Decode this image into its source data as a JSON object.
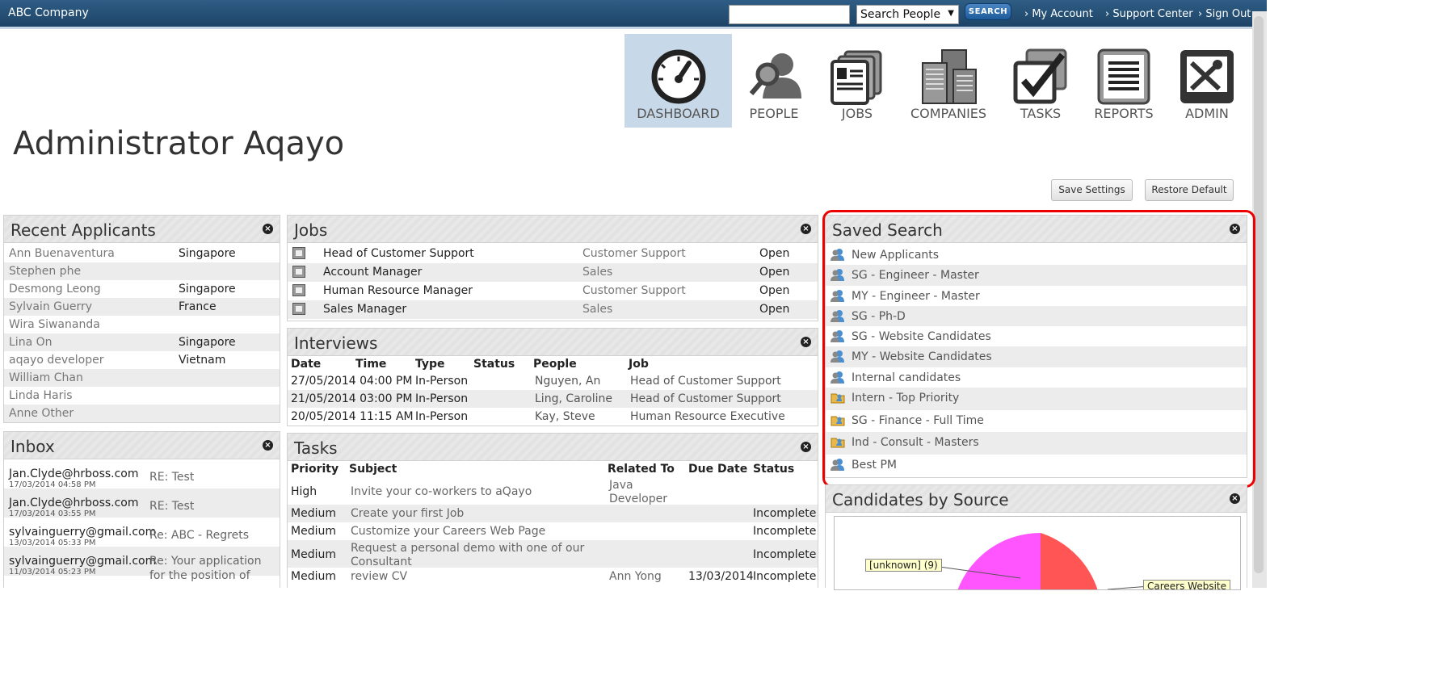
{
  "header": {
    "brand": "ABC Company",
    "search_placeholder": "",
    "search_select": "Search People",
    "search_button": "SEARCH",
    "links": [
      "My Account",
      "Support Center",
      "Sign Out"
    ]
  },
  "nav": [
    {
      "label": "DASHBOARD",
      "icon": "dashboard-gauge-icon"
    },
    {
      "label": "PEOPLE",
      "icon": "people-search-icon"
    },
    {
      "label": "JOBS",
      "icon": "jobs-cards-icon"
    },
    {
      "label": "COMPANIES",
      "icon": "companies-buildings-icon"
    },
    {
      "label": "TASKS",
      "icon": "tasks-check-icon"
    },
    {
      "label": "REPORTS",
      "icon": "reports-document-icon"
    },
    {
      "label": "ADMIN",
      "icon": "admin-tools-icon"
    }
  ],
  "page_title": "Administrator Aqayo",
  "buttons": {
    "save": "Save Settings",
    "restore": "Restore Default"
  },
  "recent_applicants": {
    "title": "Recent Applicants",
    "rows": [
      [
        "Ann Buenaventura",
        "Singapore"
      ],
      [
        "Stephen phe",
        ""
      ],
      [
        "Desmong Leong",
        "Singapore"
      ],
      [
        "Sylvain Guerry",
        "France"
      ],
      [
        "Wira Siwananda",
        ""
      ],
      [
        "Lina On",
        "Singapore"
      ],
      [
        "aqayo developer",
        "Vietnam"
      ],
      [
        "William Chan",
        ""
      ],
      [
        "Linda Haris",
        ""
      ],
      [
        "Anne Other",
        ""
      ]
    ]
  },
  "inbox": {
    "title": "Inbox",
    "rows": [
      {
        "from": "Jan.Clyde@hrboss.com",
        "date": "17/03/2014 04:58 PM",
        "subject": "RE: Test",
        "subject2": ""
      },
      {
        "from": "Jan.Clyde@hrboss.com",
        "date": "17/03/2014 03:55 PM",
        "subject": "RE: Test",
        "subject2": ""
      },
      {
        "from": "sylvainguerry@gmail.com",
        "date": "13/03/2014 05:33 PM",
        "subject": "Re: ABC - Regrets",
        "subject2": ""
      },
      {
        "from": "sylvainguerry@gmail.com",
        "date": "11/03/2014 05:23 PM",
        "subject": "Re: Your application",
        "subject2": "for the position of"
      }
    ]
  },
  "jobs": {
    "title": "Jobs",
    "rows": [
      [
        "Head of Customer Support",
        "Customer Support",
        "Open"
      ],
      [
        "Account Manager",
        "Sales",
        "Open"
      ],
      [
        "Human Resource Manager",
        "Customer Support",
        "Open"
      ],
      [
        "Sales Manager",
        "Sales",
        "Open"
      ]
    ]
  },
  "interviews": {
    "title": "Interviews",
    "headers": [
      "Date",
      "Time",
      "Type",
      "Status",
      "People",
      "Job"
    ],
    "rows": [
      [
        "27/05/2014",
        "04:00 PM",
        "In-Person",
        "",
        "Nguyen, An",
        "Head of Customer Support"
      ],
      [
        "21/05/2014",
        "03:00 PM",
        "In-Person",
        "",
        "Ling, Caroline",
        "Head of Customer Support"
      ],
      [
        "20/05/2014",
        "11:15 AM",
        "In-Person",
        "",
        "Kay, Steve",
        "Human Resource Executive"
      ]
    ]
  },
  "tasks": {
    "title": "Tasks",
    "headers": [
      "Priority",
      "Subject",
      "Related To",
      "Due Date",
      "Status"
    ],
    "rows": [
      {
        "priority": "High",
        "subject": "Invite your co-workers to aQayo",
        "subject2": "",
        "related": "Java",
        "related2": "Developer",
        "due": "",
        "status": ""
      },
      {
        "priority": "Medium",
        "subject": "Create your first Job",
        "subject2": "",
        "related": "",
        "related2": "",
        "due": "",
        "status": "Incomplete"
      },
      {
        "priority": "Medium",
        "subject": "Customize your Careers Web Page",
        "subject2": "",
        "related": "",
        "related2": "",
        "due": "",
        "status": "Incomplete"
      },
      {
        "priority": "Medium",
        "subject": "Request a personal demo with one of our",
        "subject2": "Consultant",
        "related": "",
        "related2": "",
        "due": "",
        "status": "Incomplete"
      },
      {
        "priority": "Medium",
        "subject": "review CV",
        "subject2": "",
        "related": "Ann Yong",
        "related2": "",
        "due": "13/03/2014",
        "status": "Incomplete"
      }
    ]
  },
  "saved_search": {
    "title": "Saved Search",
    "items": [
      {
        "label": "New Applicants",
        "icon": "people-icon"
      },
      {
        "label": "SG - Engineer - Master",
        "icon": "people-icon"
      },
      {
        "label": "MY - Engineer - Master",
        "icon": "people-icon"
      },
      {
        "label": "SG - Ph-D",
        "icon": "people-icon"
      },
      {
        "label": "SG - Website Candidates",
        "icon": "people-icon"
      },
      {
        "label": "MY - Website Candidates",
        "icon": "people-icon"
      },
      {
        "label": "Internal candidates",
        "icon": "people-icon"
      },
      {
        "label": "Intern - Top Priority",
        "icon": "folder-icon"
      },
      {
        "label": "SG - Finance - Full Time",
        "icon": "folder-icon"
      },
      {
        "label": "Ind - Consult - Masters",
        "icon": "folder-icon"
      },
      {
        "label": "Best PM",
        "icon": "people-icon"
      }
    ]
  },
  "candidates_by_source": {
    "title": "Candidates by Source"
  },
  "chart_data": {
    "type": "pie",
    "labels": [
      "[unknown] (9)",
      "Careers Website"
    ],
    "colors": [
      "#ff55ff",
      "#ff5555"
    ]
  }
}
